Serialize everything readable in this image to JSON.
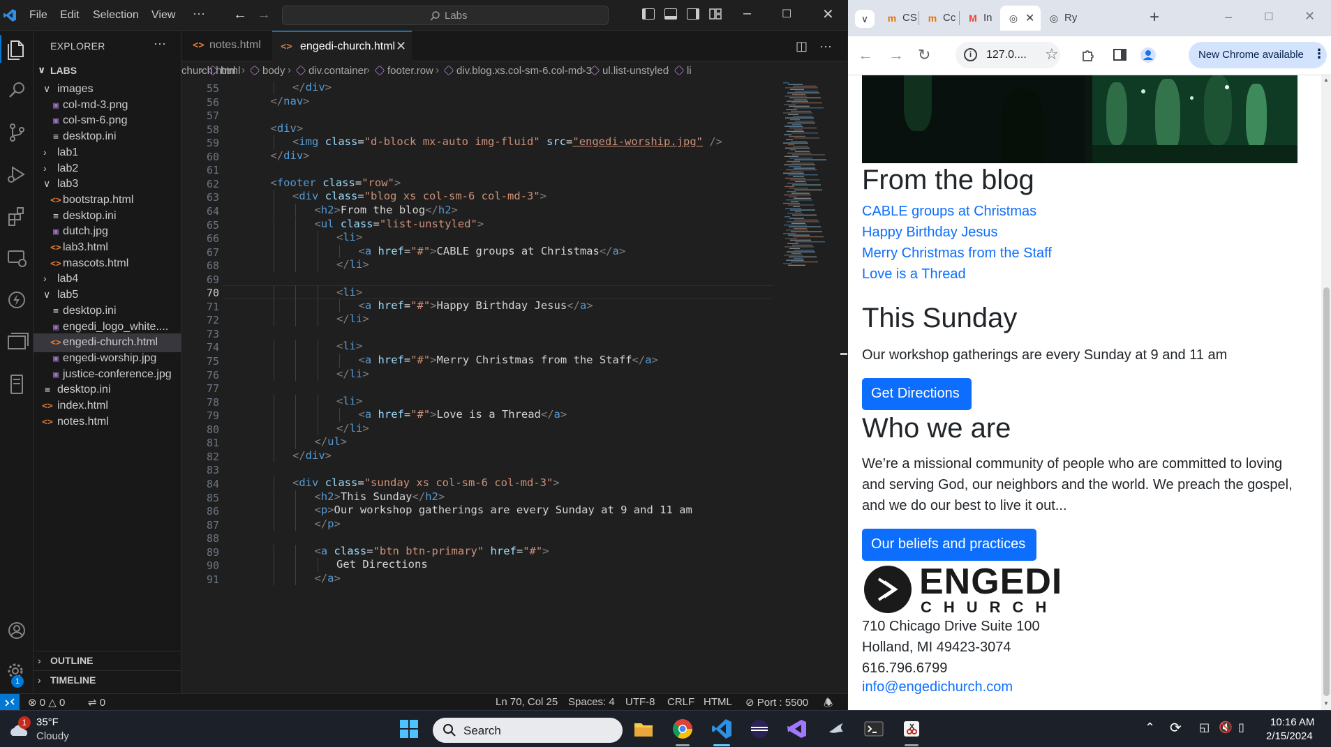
{
  "vscode": {
    "menu": [
      "File",
      "Edit",
      "Selection",
      "View"
    ],
    "more": "···",
    "search_label": "Labs",
    "explorer_title": "EXPLORER",
    "explorer_more": "···",
    "workspace": "LABS",
    "tree": [
      {
        "label": "images",
        "type": "folder",
        "open": true,
        "depth": 1
      },
      {
        "label": "col-md-3.png",
        "type": "img",
        "depth": 2
      },
      {
        "label": "col-sm-6.png",
        "type": "img",
        "depth": 2
      },
      {
        "label": "desktop.ini",
        "type": "ini",
        "depth": 2
      },
      {
        "label": "lab1",
        "type": "folder",
        "open": false,
        "depth": 1
      },
      {
        "label": "lab2",
        "type": "folder",
        "open": false,
        "depth": 1
      },
      {
        "label": "lab3",
        "type": "folder",
        "open": true,
        "depth": 1
      },
      {
        "label": "bootstrap.html",
        "type": "html",
        "depth": 2
      },
      {
        "label": "desktop.ini",
        "type": "ini",
        "depth": 2
      },
      {
        "label": "dutch.jpg",
        "type": "img",
        "depth": 2
      },
      {
        "label": "lab3.html",
        "type": "html",
        "depth": 2
      },
      {
        "label": "mascots.html",
        "type": "html",
        "depth": 2
      },
      {
        "label": "lab4",
        "type": "folder",
        "open": false,
        "depth": 1
      },
      {
        "label": "lab5",
        "type": "folder",
        "open": true,
        "depth": 1
      },
      {
        "label": "desktop.ini",
        "type": "ini",
        "depth": 2
      },
      {
        "label": "engedi_logo_white....",
        "type": "img",
        "depth": 2
      },
      {
        "label": "engedi-church.html",
        "type": "html",
        "depth": 2,
        "selected": true
      },
      {
        "label": "engedi-worship.jpg",
        "type": "img",
        "depth": 2
      },
      {
        "label": "justice-conference.jpg",
        "type": "img",
        "depth": 2
      },
      {
        "label": "desktop.ini",
        "type": "ini",
        "depth": 1
      },
      {
        "label": "index.html",
        "type": "html",
        "depth": 1
      },
      {
        "label": "notes.html",
        "type": "html",
        "depth": 1
      }
    ],
    "outline": "OUTLINE",
    "timeline": "TIMELINE",
    "tabs": [
      {
        "label": "notes.html",
        "active": false
      },
      {
        "label": "engedi-church.html",
        "active": true
      }
    ],
    "breadcrumb": [
      "church.html",
      "html",
      "body",
      "div.container",
      "footer.row",
      "div.blog.xs.col-sm-6.col-md-3",
      "ul.list-unstyled",
      "li"
    ],
    "line_start": 55,
    "current_line": 70,
    "code_lines": [
      {
        "indent": 2,
        "tokens": [
          [
            "ab",
            "</"
          ],
          [
            "tg",
            "div"
          ],
          [
            "ab",
            ">"
          ]
        ]
      },
      {
        "indent": 1,
        "tokens": [
          [
            "ab",
            "</"
          ],
          [
            "tg",
            "nav"
          ],
          [
            "ab",
            ">"
          ]
        ]
      },
      {
        "indent": 0,
        "tokens": []
      },
      {
        "indent": 1,
        "tokens": [
          [
            "ab",
            "<"
          ],
          [
            "tg",
            "div"
          ],
          [
            "ab",
            ">"
          ]
        ]
      },
      {
        "indent": 2,
        "tokens": [
          [
            "ab",
            "<"
          ],
          [
            "tg",
            "img"
          ],
          [
            "tx",
            " "
          ],
          [
            "at",
            "class"
          ],
          [
            "tx",
            "="
          ],
          [
            "st",
            "\"d-block mx-auto img-fluid\""
          ],
          [
            "tx",
            " "
          ],
          [
            "at",
            "src"
          ],
          [
            "tx",
            "="
          ],
          [
            "st",
            "\"engedi-worship.jpg\""
          ],
          [
            "tx",
            " "
          ],
          [
            "ab",
            "/>"
          ]
        ]
      },
      {
        "indent": 1,
        "tokens": [
          [
            "ab",
            "</"
          ],
          [
            "tg",
            "div"
          ],
          [
            "ab",
            ">"
          ]
        ]
      },
      {
        "indent": 0,
        "tokens": []
      },
      {
        "indent": 1,
        "tokens": [
          [
            "ab",
            "<"
          ],
          [
            "tg",
            "footer"
          ],
          [
            "tx",
            " "
          ],
          [
            "at",
            "class"
          ],
          [
            "tx",
            "="
          ],
          [
            "st",
            "\"row\""
          ],
          [
            "ab",
            ">"
          ]
        ]
      },
      {
        "indent": 2,
        "tokens": [
          [
            "ab",
            "<"
          ],
          [
            "tg",
            "div"
          ],
          [
            "tx",
            " "
          ],
          [
            "at",
            "class"
          ],
          [
            "tx",
            "="
          ],
          [
            "st",
            "\"blog xs col-sm-6 col-md-3\""
          ],
          [
            "ab",
            ">"
          ]
        ]
      },
      {
        "indent": 3,
        "tokens": [
          [
            "ab",
            "<"
          ],
          [
            "tg",
            "h2"
          ],
          [
            "ab",
            ">"
          ],
          [
            "tx",
            "From the blog"
          ],
          [
            "ab",
            "</"
          ],
          [
            "tg",
            "h2"
          ],
          [
            "ab",
            ">"
          ]
        ]
      },
      {
        "indent": 3,
        "tokens": [
          [
            "ab",
            "<"
          ],
          [
            "tg",
            "ul"
          ],
          [
            "tx",
            " "
          ],
          [
            "at",
            "class"
          ],
          [
            "tx",
            "="
          ],
          [
            "st",
            "\"list-unstyled\""
          ],
          [
            "ab",
            ">"
          ]
        ]
      },
      {
        "indent": 4,
        "tokens": [
          [
            "ab",
            "<"
          ],
          [
            "tg",
            "li"
          ],
          [
            "ab",
            ">"
          ]
        ]
      },
      {
        "indent": 5,
        "tokens": [
          [
            "ab",
            "<"
          ],
          [
            "tg",
            "a"
          ],
          [
            "tx",
            " "
          ],
          [
            "at",
            "href"
          ],
          [
            "tx",
            "="
          ],
          [
            "st",
            "\"#\""
          ],
          [
            "ab",
            ">"
          ],
          [
            "tx",
            "CABLE groups at Christmas"
          ],
          [
            "ab",
            "</"
          ],
          [
            "tg",
            "a"
          ],
          [
            "ab",
            ">"
          ]
        ]
      },
      {
        "indent": 4,
        "tokens": [
          [
            "ab",
            "</"
          ],
          [
            "tg",
            "li"
          ],
          [
            "ab",
            ">"
          ]
        ]
      },
      {
        "indent": 0,
        "tokens": []
      },
      {
        "indent": 4,
        "tokens": [
          [
            "ab",
            "<"
          ],
          [
            "tg",
            "li"
          ],
          [
            "ab",
            ">"
          ]
        ]
      },
      {
        "indent": 5,
        "tokens": [
          [
            "ab",
            "<"
          ],
          [
            "tg",
            "a"
          ],
          [
            "tx",
            " "
          ],
          [
            "at",
            "href"
          ],
          [
            "tx",
            "="
          ],
          [
            "st",
            "\"#\""
          ],
          [
            "ab",
            ">"
          ],
          [
            "tx",
            "Happy Birthday Jesus"
          ],
          [
            "ab",
            "</"
          ],
          [
            "tg",
            "a"
          ],
          [
            "ab",
            ">"
          ]
        ]
      },
      {
        "indent": 4,
        "tokens": [
          [
            "ab",
            "</"
          ],
          [
            "tg",
            "li"
          ],
          [
            "ab",
            ">"
          ]
        ]
      },
      {
        "indent": 0,
        "tokens": []
      },
      {
        "indent": 4,
        "tokens": [
          [
            "ab",
            "<"
          ],
          [
            "tg",
            "li"
          ],
          [
            "ab",
            ">"
          ]
        ]
      },
      {
        "indent": 5,
        "tokens": [
          [
            "ab",
            "<"
          ],
          [
            "tg",
            "a"
          ],
          [
            "tx",
            " "
          ],
          [
            "at",
            "href"
          ],
          [
            "tx",
            "="
          ],
          [
            "st",
            "\"#\""
          ],
          [
            "ab",
            ">"
          ],
          [
            "tx",
            "Merry Christmas from the Staff"
          ],
          [
            "ab",
            "</"
          ],
          [
            "tg",
            "a"
          ],
          [
            "ab",
            ">"
          ]
        ]
      },
      {
        "indent": 4,
        "tokens": [
          [
            "ab",
            "</"
          ],
          [
            "tg",
            "li"
          ],
          [
            "ab",
            ">"
          ]
        ]
      },
      {
        "indent": 0,
        "tokens": []
      },
      {
        "indent": 4,
        "tokens": [
          [
            "ab",
            "<"
          ],
          [
            "tg",
            "li"
          ],
          [
            "ab",
            ">"
          ]
        ]
      },
      {
        "indent": 5,
        "tokens": [
          [
            "ab",
            "<"
          ],
          [
            "tg",
            "a"
          ],
          [
            "tx",
            " "
          ],
          [
            "at",
            "href"
          ],
          [
            "tx",
            "="
          ],
          [
            "st",
            "\"#\""
          ],
          [
            "ab",
            ">"
          ],
          [
            "tx",
            "Love is a Thread"
          ],
          [
            "ab",
            "</"
          ],
          [
            "tg",
            "a"
          ],
          [
            "ab",
            ">"
          ]
        ]
      },
      {
        "indent": 4,
        "tokens": [
          [
            "ab",
            "</"
          ],
          [
            "tg",
            "li"
          ],
          [
            "ab",
            ">"
          ]
        ]
      },
      {
        "indent": 3,
        "tokens": [
          [
            "ab",
            "</"
          ],
          [
            "tg",
            "ul"
          ],
          [
            "ab",
            ">"
          ]
        ]
      },
      {
        "indent": 2,
        "tokens": [
          [
            "ab",
            "</"
          ],
          [
            "tg",
            "div"
          ],
          [
            "ab",
            ">"
          ]
        ]
      },
      {
        "indent": 0,
        "tokens": []
      },
      {
        "indent": 2,
        "tokens": [
          [
            "ab",
            "<"
          ],
          [
            "tg",
            "div"
          ],
          [
            "tx",
            " "
          ],
          [
            "at",
            "class"
          ],
          [
            "tx",
            "="
          ],
          [
            "st",
            "\"sunday xs col-sm-6 col-md-3\""
          ],
          [
            "ab",
            ">"
          ]
        ]
      },
      {
        "indent": 3,
        "tokens": [
          [
            "ab",
            "<"
          ],
          [
            "tg",
            "h2"
          ],
          [
            "ab",
            ">"
          ],
          [
            "tx",
            "This Sunday"
          ],
          [
            "ab",
            "</"
          ],
          [
            "tg",
            "h2"
          ],
          [
            "ab",
            ">"
          ]
        ]
      },
      {
        "indent": 3,
        "tokens": [
          [
            "ab",
            "<"
          ],
          [
            "tg",
            "p"
          ],
          [
            "ab",
            ">"
          ],
          [
            "tx",
            "Our workshop gatherings are every Sunday at 9 and 11 am"
          ]
        ]
      },
      {
        "indent": 3,
        "tokens": [
          [
            "ab",
            "</"
          ],
          [
            "tg",
            "p"
          ],
          [
            "ab",
            ">"
          ]
        ]
      },
      {
        "indent": 0,
        "tokens": []
      },
      {
        "indent": 3,
        "tokens": [
          [
            "ab",
            "<"
          ],
          [
            "tg",
            "a"
          ],
          [
            "tx",
            " "
          ],
          [
            "at",
            "class"
          ],
          [
            "tx",
            "="
          ],
          [
            "st",
            "\"btn btn-primary\""
          ],
          [
            "tx",
            " "
          ],
          [
            "at",
            "href"
          ],
          [
            "tx",
            "="
          ],
          [
            "st",
            "\"#\""
          ],
          [
            "ab",
            ">"
          ]
        ]
      },
      {
        "indent": 4,
        "tokens": [
          [
            "tx",
            "Get Directions"
          ]
        ]
      },
      {
        "indent": 3,
        "tokens": [
          [
            "ab",
            "</"
          ],
          [
            "tg",
            "a"
          ],
          [
            "ab",
            ">"
          ]
        ]
      }
    ],
    "status": {
      "errors": "0",
      "warnings": "0",
      "ports": "0",
      "position": "Ln 70, Col 25",
      "spaces": "Spaces: 4",
      "encoding": "UTF-8",
      "eol": "CRLF",
      "language": "HTML",
      "port": "Port : 5500"
    },
    "account_badge": "1"
  },
  "chrome": {
    "tabs": [
      {
        "title": "CS",
        "favicon": "m",
        "color": "#e8710a"
      },
      {
        "title": "Cc",
        "favicon": "m",
        "color": "#e8710a"
      },
      {
        "title": "In",
        "favicon": "M",
        "color": "#ea4335"
      },
      {
        "title": "",
        "favicon": "globe",
        "color": "#3c4043",
        "active": true
      },
      {
        "title": "Ry",
        "favicon": "globe",
        "color": "#3c4043"
      }
    ],
    "url": "127.0....",
    "new_chrome": "New Chrome available",
    "page": {
      "blog_title": "From the blog",
      "blog_links": [
        "CABLE groups at Christmas",
        "Happy Birthday Jesus",
        "Merry Christmas from the Staff",
        "Love is a Thread"
      ],
      "sunday_title": "This Sunday",
      "sunday_text": "Our workshop gatherings are every Sunday at 9 and 11 am",
      "directions_btn": "Get Directions",
      "who_title": "Who we are",
      "who_lines": [
        "We’re a missional community of people who are committed to loving",
        "and serving God, our neighbors and the world. We preach the gospel,",
        "and we do our best to live it out..."
      ],
      "beliefs_btn": "Our beliefs and practices",
      "logo_word": "ENGEDI",
      "logo_sub": "CHURCH",
      "address_lines": [
        "710 Chicago Drive Suite 100",
        "Holland, MI 49423-3074",
        "616.796.6799"
      ],
      "email": "info@engedichurch.com"
    }
  },
  "taskbar": {
    "weather_temp": "35°F",
    "weather_desc": "Cloudy",
    "weather_badge": "1",
    "search": "Search",
    "time": "10:16 AM",
    "date": "2/15/2024"
  }
}
